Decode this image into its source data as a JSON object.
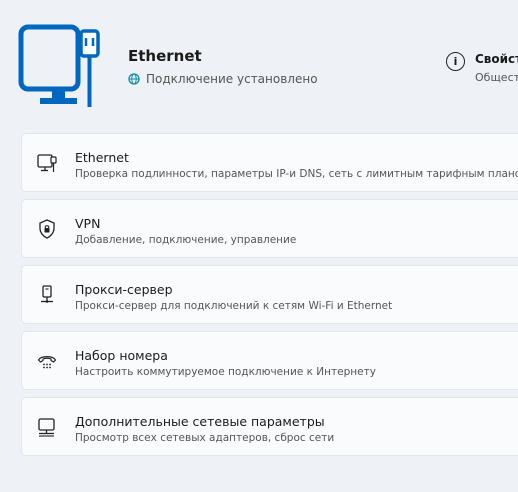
{
  "header": {
    "title": "Ethernet",
    "status": "Подключение установлено",
    "properties_title": "Свойст",
    "properties_subtitle": "Общест"
  },
  "items": [
    {
      "title": "Ethernet",
      "description": "Проверка подлинности, параметры IP-и DNS, сеть с лимитным тарифным планом",
      "icon": "ethernet-monitor-icon"
    },
    {
      "title": "VPN",
      "description": "Добавление, подключение, управление",
      "icon": "shield-icon"
    },
    {
      "title": "Прокси-сервер",
      "description": "Прокси-сервер для подключений к сетям Wi-Fi и Ethernet",
      "icon": "proxy-server-icon"
    },
    {
      "title": "Набор номера",
      "description": "Настроить коммутируемое подключение к Интернету",
      "icon": "dialup-phone-icon"
    },
    {
      "title": "Дополнительные сетевые параметры",
      "description": "Просмотр всех сетевых адаптеров, сброс сети",
      "icon": "network-adapter-icon"
    }
  ],
  "colors": {
    "accent": "#0067c0",
    "background": "#eef1f6",
    "card": "#fafbfc"
  }
}
